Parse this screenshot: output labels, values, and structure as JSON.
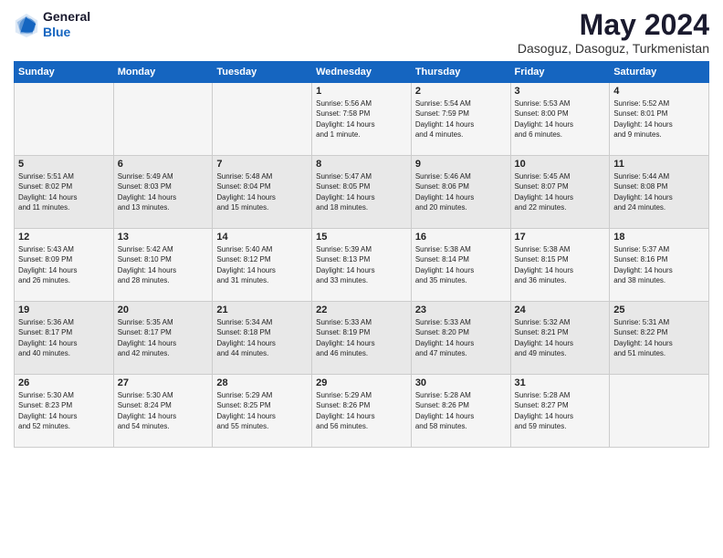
{
  "header": {
    "logo_line1": "General",
    "logo_line2": "Blue",
    "month": "May 2024",
    "location": "Dasoguz, Dasoguz, Turkmenistan"
  },
  "weekdays": [
    "Sunday",
    "Monday",
    "Tuesday",
    "Wednesday",
    "Thursday",
    "Friday",
    "Saturday"
  ],
  "weeks": [
    [
      {
        "day": "",
        "content": ""
      },
      {
        "day": "",
        "content": ""
      },
      {
        "day": "",
        "content": ""
      },
      {
        "day": "1",
        "content": "Sunrise: 5:56 AM\nSunset: 7:58 PM\nDaylight: 14 hours\nand 1 minute."
      },
      {
        "day": "2",
        "content": "Sunrise: 5:54 AM\nSunset: 7:59 PM\nDaylight: 14 hours\nand 4 minutes."
      },
      {
        "day": "3",
        "content": "Sunrise: 5:53 AM\nSunset: 8:00 PM\nDaylight: 14 hours\nand 6 minutes."
      },
      {
        "day": "4",
        "content": "Sunrise: 5:52 AM\nSunset: 8:01 PM\nDaylight: 14 hours\nand 9 minutes."
      }
    ],
    [
      {
        "day": "5",
        "content": "Sunrise: 5:51 AM\nSunset: 8:02 PM\nDaylight: 14 hours\nand 11 minutes."
      },
      {
        "day": "6",
        "content": "Sunrise: 5:49 AM\nSunset: 8:03 PM\nDaylight: 14 hours\nand 13 minutes."
      },
      {
        "day": "7",
        "content": "Sunrise: 5:48 AM\nSunset: 8:04 PM\nDaylight: 14 hours\nand 15 minutes."
      },
      {
        "day": "8",
        "content": "Sunrise: 5:47 AM\nSunset: 8:05 PM\nDaylight: 14 hours\nand 18 minutes."
      },
      {
        "day": "9",
        "content": "Sunrise: 5:46 AM\nSunset: 8:06 PM\nDaylight: 14 hours\nand 20 minutes."
      },
      {
        "day": "10",
        "content": "Sunrise: 5:45 AM\nSunset: 8:07 PM\nDaylight: 14 hours\nand 22 minutes."
      },
      {
        "day": "11",
        "content": "Sunrise: 5:44 AM\nSunset: 8:08 PM\nDaylight: 14 hours\nand 24 minutes."
      }
    ],
    [
      {
        "day": "12",
        "content": "Sunrise: 5:43 AM\nSunset: 8:09 PM\nDaylight: 14 hours\nand 26 minutes."
      },
      {
        "day": "13",
        "content": "Sunrise: 5:42 AM\nSunset: 8:10 PM\nDaylight: 14 hours\nand 28 minutes."
      },
      {
        "day": "14",
        "content": "Sunrise: 5:40 AM\nSunset: 8:12 PM\nDaylight: 14 hours\nand 31 minutes."
      },
      {
        "day": "15",
        "content": "Sunrise: 5:39 AM\nSunset: 8:13 PM\nDaylight: 14 hours\nand 33 minutes."
      },
      {
        "day": "16",
        "content": "Sunrise: 5:38 AM\nSunset: 8:14 PM\nDaylight: 14 hours\nand 35 minutes."
      },
      {
        "day": "17",
        "content": "Sunrise: 5:38 AM\nSunset: 8:15 PM\nDaylight: 14 hours\nand 36 minutes."
      },
      {
        "day": "18",
        "content": "Sunrise: 5:37 AM\nSunset: 8:16 PM\nDaylight: 14 hours\nand 38 minutes."
      }
    ],
    [
      {
        "day": "19",
        "content": "Sunrise: 5:36 AM\nSunset: 8:17 PM\nDaylight: 14 hours\nand 40 minutes."
      },
      {
        "day": "20",
        "content": "Sunrise: 5:35 AM\nSunset: 8:17 PM\nDaylight: 14 hours\nand 42 minutes."
      },
      {
        "day": "21",
        "content": "Sunrise: 5:34 AM\nSunset: 8:18 PM\nDaylight: 14 hours\nand 44 minutes."
      },
      {
        "day": "22",
        "content": "Sunrise: 5:33 AM\nSunset: 8:19 PM\nDaylight: 14 hours\nand 46 minutes."
      },
      {
        "day": "23",
        "content": "Sunrise: 5:33 AM\nSunset: 8:20 PM\nDaylight: 14 hours\nand 47 minutes."
      },
      {
        "day": "24",
        "content": "Sunrise: 5:32 AM\nSunset: 8:21 PM\nDaylight: 14 hours\nand 49 minutes."
      },
      {
        "day": "25",
        "content": "Sunrise: 5:31 AM\nSunset: 8:22 PM\nDaylight: 14 hours\nand 51 minutes."
      }
    ],
    [
      {
        "day": "26",
        "content": "Sunrise: 5:30 AM\nSunset: 8:23 PM\nDaylight: 14 hours\nand 52 minutes."
      },
      {
        "day": "27",
        "content": "Sunrise: 5:30 AM\nSunset: 8:24 PM\nDaylight: 14 hours\nand 54 minutes."
      },
      {
        "day": "28",
        "content": "Sunrise: 5:29 AM\nSunset: 8:25 PM\nDaylight: 14 hours\nand 55 minutes."
      },
      {
        "day": "29",
        "content": "Sunrise: 5:29 AM\nSunset: 8:26 PM\nDaylight: 14 hours\nand 56 minutes."
      },
      {
        "day": "30",
        "content": "Sunrise: 5:28 AM\nSunset: 8:26 PM\nDaylight: 14 hours\nand 58 minutes."
      },
      {
        "day": "31",
        "content": "Sunrise: 5:28 AM\nSunset: 8:27 PM\nDaylight: 14 hours\nand 59 minutes."
      },
      {
        "day": "",
        "content": ""
      }
    ]
  ]
}
